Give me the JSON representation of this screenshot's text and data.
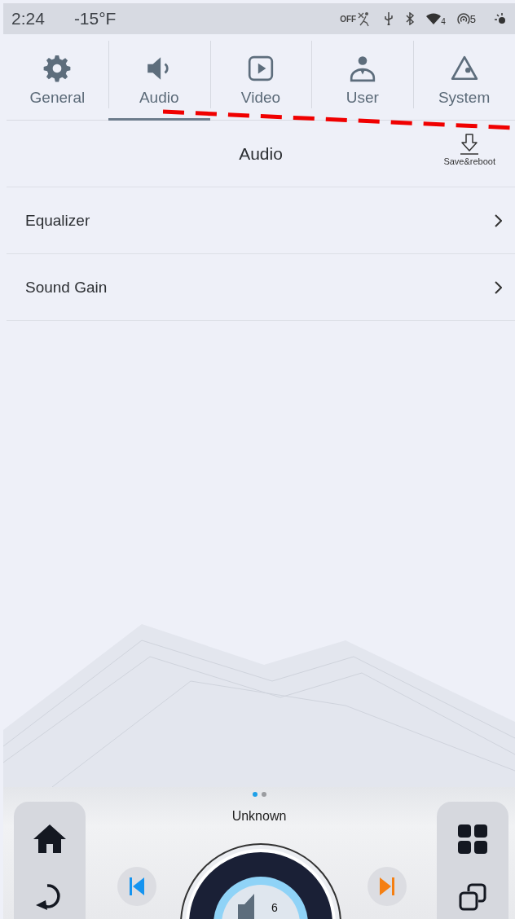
{
  "status_bar": {
    "time": "2:24",
    "temperature": "-15°F",
    "airbag": "OFF",
    "wifi_badge": "4",
    "hotspot_badge": "5"
  },
  "tabs": [
    {
      "label": "General",
      "kind": "gear",
      "selected": false
    },
    {
      "label": "Audio",
      "kind": "speaker",
      "selected": true
    },
    {
      "label": "Video",
      "kind": "play",
      "selected": false
    },
    {
      "label": "User",
      "kind": "user",
      "selected": false
    },
    {
      "label": "System",
      "kind": "system",
      "selected": false
    }
  ],
  "header": {
    "title": "Audio",
    "action": "Save&reboot"
  },
  "items": [
    {
      "label": "Equalizer"
    },
    {
      "label": "Sound Gain"
    }
  ],
  "dock": {
    "pages": [
      {
        "selected": true
      },
      {
        "selected": false
      }
    ],
    "track": "Unknown",
    "volume": "6"
  }
}
